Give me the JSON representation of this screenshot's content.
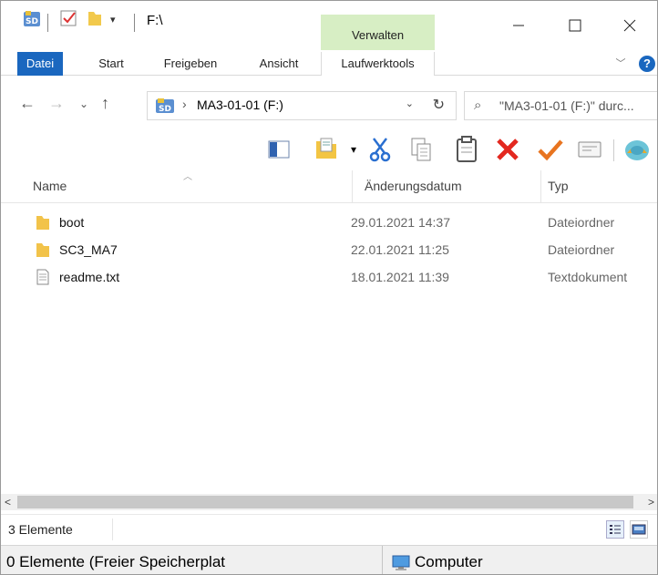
{
  "titlebar": {
    "path": "F:\\",
    "context_tab_group": "Verwalten"
  },
  "ribbon": {
    "tabs": [
      "Datei",
      "Start",
      "Freigeben",
      "Ansicht",
      "Laufwerktools"
    ],
    "help": "?"
  },
  "address": {
    "drive_label": "MA3-01-01 (F:)",
    "search_placeholder": "\"MA3-01-01 (F:)\" durc..."
  },
  "columns": {
    "name": "Name",
    "date": "Änderungsdatum",
    "type": "Typ"
  },
  "files": [
    {
      "name": "boot",
      "date": "29.01.2021 14:37",
      "type": "Dateiordner",
      "icon": "folder-icon"
    },
    {
      "name": "SC3_MA7",
      "date": "22.01.2021 11:25",
      "type": "Dateiordner",
      "icon": "folder-icon"
    },
    {
      "name": "readme.txt",
      "date": "18.01.2021 11:39",
      "type": "Textdokument",
      "icon": "text-file-icon"
    }
  ],
  "status": {
    "count": "3 Elemente"
  },
  "bottom": {
    "left": "0 Elemente (Freier Speicherplat",
    "right": "Computer"
  },
  "colors": {
    "file_tab": "#1a67bf",
    "context_tab": "#d7eec4",
    "delete_red": "#e3281f",
    "check_orange": "#e8741f"
  }
}
